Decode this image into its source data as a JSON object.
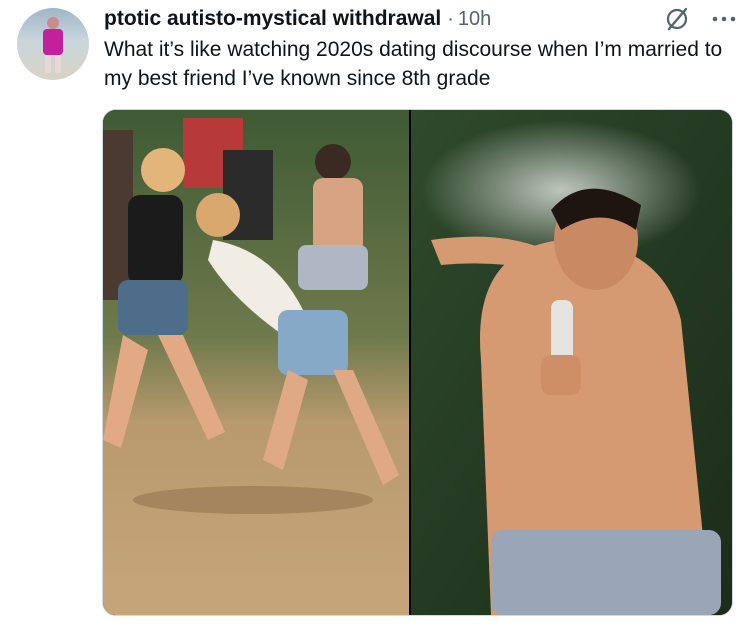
{
  "tweet": {
    "author_name": "ptotic autisto-mystical withdrawal",
    "separator": "·",
    "timestamp": "10h",
    "text": "What it’s like watching 2020s dating discourse when I’m married to my best friend I’ve known since 8th grade",
    "icons": [
      "grok-slash-icon",
      "more-options-icon"
    ]
  },
  "media": {
    "panels": [
      "left-photo",
      "right-photo"
    ]
  },
  "colors": {
    "text_primary": "#0f1419",
    "text_secondary": "#536471",
    "border": "#cfd9de"
  }
}
